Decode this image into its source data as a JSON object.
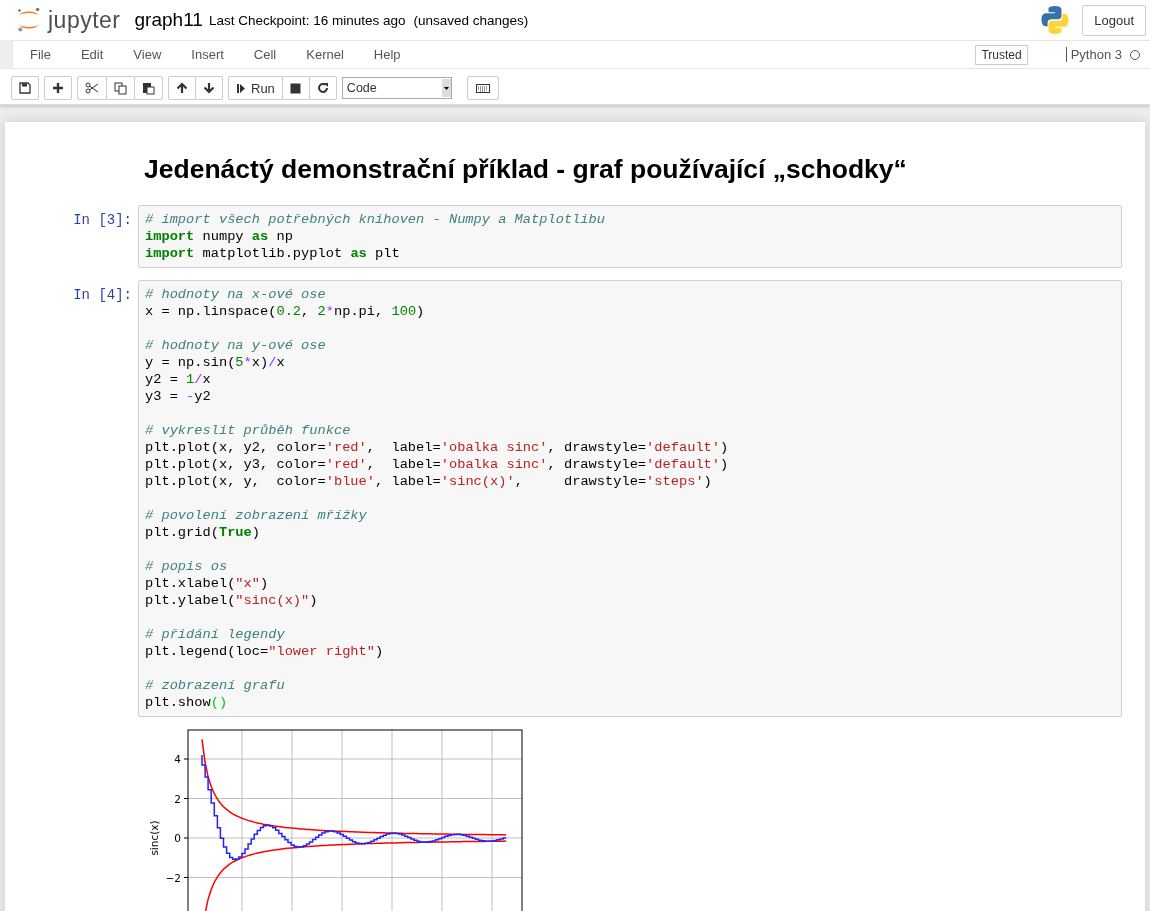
{
  "header": {
    "logo_text": "jupyter",
    "notebook_name": "graph11",
    "checkpoint": "Last Checkpoint: 16 minutes ago",
    "autosave_status": "(unsaved changes)",
    "logout": "Logout"
  },
  "menu": {
    "items": [
      "File",
      "Edit",
      "View",
      "Insert",
      "Cell",
      "Kernel",
      "Help"
    ],
    "trusted": "Trusted",
    "kernel_name": "Python 3",
    "kernel_busy": false
  },
  "toolbar": {
    "run_label": "Run",
    "cell_type": "Code"
  },
  "heading": "Jedenáctý demonstrační příklad - graf používající „schodky“",
  "cells": [
    {
      "prompt": "In [3]:",
      "blocks": [
        [
          [
            {
              "kind": "comment",
              "text": "# import všech potřebných knihoven - Numpy a Matplotlibu"
            }
          ],
          [
            {
              "kind": "keyword",
              "text": "import"
            },
            {
              "kind": "plain",
              "text": " numpy "
            },
            {
              "kind": "keyword",
              "text": "as"
            },
            {
              "kind": "plain",
              "text": " np"
            }
          ],
          [
            {
              "kind": "keyword",
              "text": "import"
            },
            {
              "kind": "plain",
              "text": " matplotlib.pyplot "
            },
            {
              "kind": "keyword",
              "text": "as"
            },
            {
              "kind": "plain",
              "text": " plt"
            }
          ]
        ]
      ]
    },
    {
      "prompt": "In [4]:",
      "blocks": [
        [
          [
            {
              "kind": "comment",
              "text": "# hodnoty na x-ové ose"
            }
          ],
          [
            {
              "kind": "plain",
              "text": "x = np.linspace("
            },
            {
              "kind": "number",
              "text": "0.2"
            },
            {
              "kind": "plain",
              "text": ", "
            },
            {
              "kind": "number",
              "text": "2"
            },
            {
              "kind": "operator",
              "text": "*"
            },
            {
              "kind": "plain",
              "text": "np.pi, "
            },
            {
              "kind": "number",
              "text": "100"
            },
            {
              "kind": "plain",
              "text": ")"
            }
          ]
        ],
        [
          [
            {
              "kind": "comment",
              "text": "# hodnoty na y-ové ose"
            }
          ],
          [
            {
              "kind": "plain",
              "text": "y = np.sin("
            },
            {
              "kind": "number",
              "text": "5"
            },
            {
              "kind": "operator",
              "text": "*"
            },
            {
              "kind": "plain",
              "text": "x)"
            },
            {
              "kind": "operator",
              "text": "/"
            },
            {
              "kind": "plain",
              "text": "x"
            }
          ],
          [
            {
              "kind": "plain",
              "text": "y2 = "
            },
            {
              "kind": "number",
              "text": "1"
            },
            {
              "kind": "operator",
              "text": "/"
            },
            {
              "kind": "plain",
              "text": "x"
            }
          ],
          [
            {
              "kind": "plain",
              "text": "y3 = "
            },
            {
              "kind": "operator",
              "text": "-"
            },
            {
              "kind": "plain",
              "text": "y2"
            }
          ]
        ],
        [
          [
            {
              "kind": "comment",
              "text": "# vykreslit průběh funkce"
            }
          ],
          [
            {
              "kind": "plain",
              "text": "plt.plot(x, y2, color="
            },
            {
              "kind": "string",
              "text": "'red'"
            },
            {
              "kind": "plain",
              "text": ",  label="
            },
            {
              "kind": "string",
              "text": "'obalka sinc'"
            },
            {
              "kind": "plain",
              "text": ", drawstyle="
            },
            {
              "kind": "string",
              "text": "'default'"
            },
            {
              "kind": "plain",
              "text": ")"
            }
          ],
          [
            {
              "kind": "plain",
              "text": "plt.plot(x, y3, color="
            },
            {
              "kind": "string",
              "text": "'red'"
            },
            {
              "kind": "plain",
              "text": ",  label="
            },
            {
              "kind": "string",
              "text": "'obalka sinc'"
            },
            {
              "kind": "plain",
              "text": ", drawstyle="
            },
            {
              "kind": "string",
              "text": "'default'"
            },
            {
              "kind": "plain",
              "text": ")"
            }
          ],
          [
            {
              "kind": "plain",
              "text": "plt.plot(x, y,  color="
            },
            {
              "kind": "string",
              "text": "'blue'"
            },
            {
              "kind": "plain",
              "text": ", label="
            },
            {
              "kind": "string",
              "text": "'sinc(x)'"
            },
            {
              "kind": "plain",
              "text": ",     drawstyle="
            },
            {
              "kind": "string",
              "text": "'steps'"
            },
            {
              "kind": "plain",
              "text": ")"
            }
          ]
        ],
        [
          [
            {
              "kind": "comment",
              "text": "# povolení zobrazení mřížky"
            }
          ],
          [
            {
              "kind": "plain",
              "text": "plt.grid("
            },
            {
              "kind": "keyword",
              "text": "True"
            },
            {
              "kind": "plain",
              "text": ")"
            }
          ]
        ],
        [
          [
            {
              "kind": "comment",
              "text": "# popis os"
            }
          ],
          [
            {
              "kind": "plain",
              "text": "plt.xlabel("
            },
            {
              "kind": "string",
              "text": "\"x\""
            },
            {
              "kind": "plain",
              "text": ")"
            }
          ],
          [
            {
              "kind": "plain",
              "text": "plt.ylabel("
            },
            {
              "kind": "string",
              "text": "\"sinc(x)\""
            },
            {
              "kind": "plain",
              "text": ")"
            }
          ]
        ],
        [
          [
            {
              "kind": "comment",
              "text": "# přidání legendy"
            }
          ],
          [
            {
              "kind": "plain",
              "text": "plt.legend(loc="
            },
            {
              "kind": "string",
              "text": "\"lower right\""
            },
            {
              "kind": "plain",
              "text": ")"
            }
          ]
        ],
        [
          [
            {
              "kind": "comment",
              "text": "# zobrazení grafu"
            }
          ],
          [
            {
              "kind": "plain",
              "text": "plt.show"
            },
            {
              "kind": "matched_bracket",
              "text": "()"
            }
          ]
        ]
      ]
    }
  ],
  "output": {
    "plot": {
      "ylabel": "sinc(x)",
      "ytick_labels": [
        "4",
        "2",
        "0",
        "−2"
      ]
    }
  }
}
